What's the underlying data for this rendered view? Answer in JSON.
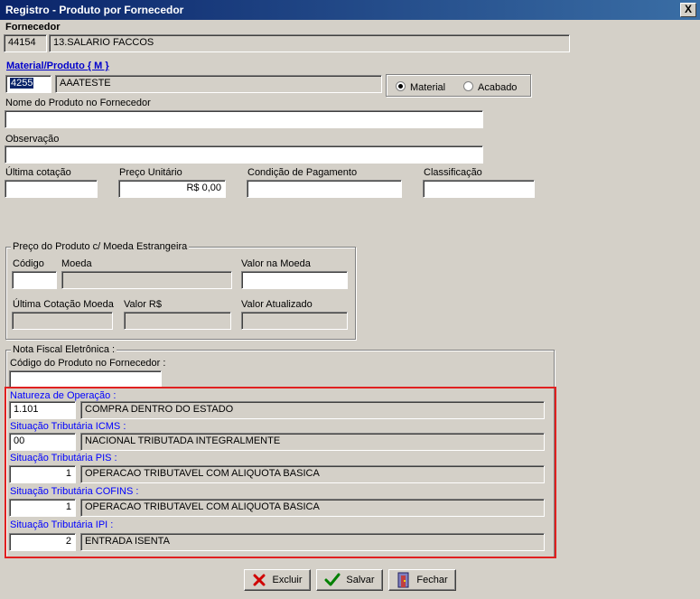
{
  "window": {
    "title": "Registro - Produto por Fornecedor",
    "close_glyph": "X"
  },
  "fornecedor": {
    "label": "Fornecedor",
    "code": "44154",
    "name": "13.SALARIO FACCOS"
  },
  "material": {
    "label": "Material/Produto { M }",
    "code": "4255",
    "name": "AAATESTE",
    "radio_material": "Material",
    "radio_acabado": "Acabado",
    "selected": "Material"
  },
  "nome_produto": {
    "label": "Nome do Produto no Fornecedor",
    "value": ""
  },
  "observacao": {
    "label": "Observação",
    "value": ""
  },
  "ultima_cotacao": {
    "label": "Última cotação",
    "value": ""
  },
  "preco_unitario": {
    "label": "Preço Unitário",
    "value": "R$ 0,00"
  },
  "condicao_pagamento": {
    "label": "Condição de Pagamento",
    "value": ""
  },
  "classificacao": {
    "label": "Classificação",
    "value": ""
  },
  "moeda_estrangeira": {
    "legend": "Preço do Produto c/ Moeda Estrangeira",
    "codigo_label": "Código",
    "codigo_value": "",
    "moeda_label": "Moeda",
    "moeda_value": "",
    "valor_moeda_label": "Valor na Moeda",
    "valor_moeda_value": "",
    "ultima_cotacao_moeda_label": "Última Cotação Moeda",
    "ultima_cotacao_moeda_value": "",
    "valor_rs_label": "Valor R$",
    "valor_rs_value": "",
    "valor_atualizado_label": "Valor Atualizado",
    "valor_atualizado_value": ""
  },
  "nfe": {
    "legend": "Nota Fiscal Eletrônica :",
    "codigo_fornecedor_label": "Código do Produto no Fornecedor :",
    "codigo_fornecedor_value": "",
    "natureza": {
      "label": "Natureza de Operação :",
      "code": "1.101",
      "desc": "COMPRA DENTRO DO ESTADO"
    },
    "icms": {
      "label": "Situação Tributária ICMS :",
      "code": "00",
      "desc": "NACIONAL TRIBUTADA INTEGRALMENTE"
    },
    "pis": {
      "label": "Situação Tributária PIS :",
      "code": "1",
      "desc": "OPERACAO TRIBUTAVEL COM ALIQUOTA BASICA"
    },
    "cofins": {
      "label": "Situação Tributária COFINS :",
      "code": "1",
      "desc": "OPERACAO TRIBUTAVEL COM ALIQUOTA BASICA"
    },
    "ipi": {
      "label": "Situação Tributária IPI :",
      "code": "2",
      "desc": "ENTRADA ISENTA"
    }
  },
  "buttons": {
    "excluir": "Excluir",
    "salvar": "Salvar",
    "fechar": "Fechar"
  },
  "colors": {
    "highlight_border": "#e02020",
    "label_blue": "#0000ff",
    "titlebar": "#0a246a"
  },
  "icons": {
    "excluir": "red-x-icon",
    "salvar": "green-check-icon",
    "fechar": "door-exit-icon"
  }
}
